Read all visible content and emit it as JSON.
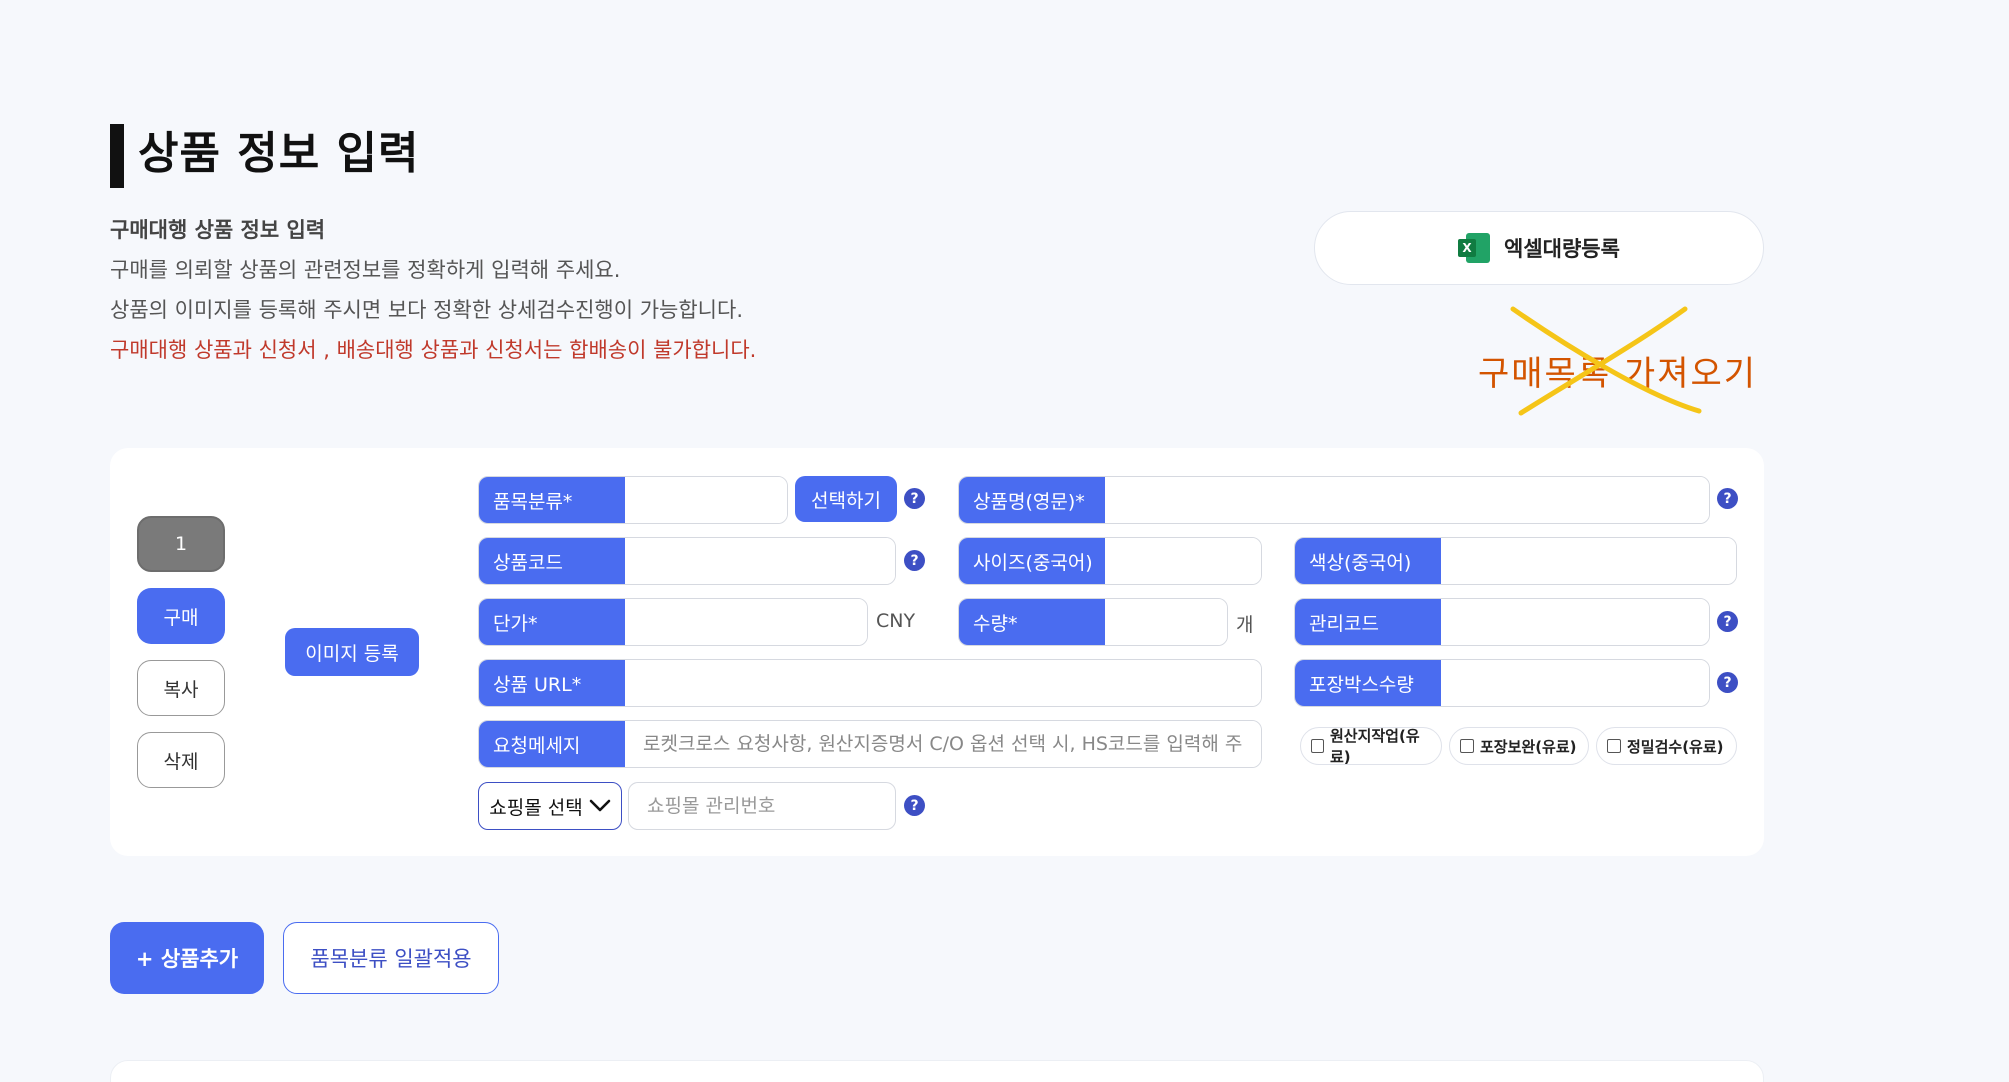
{
  "header": {
    "title": "상품 정보 입력",
    "subtitle": "구매대행 상품 정보 입력",
    "desc1": "구매를 의뢰할 상품의 관련정보를 정확하게 입력해 주세요.",
    "desc2": "상품의 이미지를 등록해 주시면 보다 정확한 상세검수진행이 가능합니다.",
    "warning": "구매대행 상품과 신청서 , 배송대행 상품과 신청서는 합배송이 불가합니다.",
    "excel_label": "엑셀대량등록",
    "excel_icon_letter": "X",
    "import_label": "구매목록 가져오기"
  },
  "item": {
    "index": "1",
    "buy_label": "구매",
    "copy_label": "복사",
    "delete_label": "삭제",
    "image_label": "이미지 등록"
  },
  "form": {
    "category_label": "품목분류*",
    "category_value": "",
    "select_label": "선택하기",
    "name_en_label": "상품명(영문)*",
    "name_en_value": "",
    "code_label": "상품코드",
    "code_value": "",
    "size_label": "사이즈(중국어)",
    "size_value": "",
    "color_label": "색상(중국어)",
    "color_value": "",
    "price_label": "단가*",
    "price_value": "",
    "price_unit": "CNY",
    "qty_label": "수량*",
    "qty_value": "",
    "qty_unit": "개",
    "mgmt_label": "관리코드",
    "mgmt_value": "",
    "url_label": "상품 URL*",
    "url_value": "",
    "box_label": "포장박스수량",
    "box_value": "",
    "request_label": "요청메세지",
    "request_placeholder": "로켓크로스 요청사항, 원산지증명서 C/O 옵션 선택 시, HS코드를 입력해 주세요",
    "mall_select_label": "쇼핑몰 선택",
    "mall_placeholder": "쇼핑몰 관리번호",
    "help_symbol": "?"
  },
  "options": [
    {
      "label": "원산지작업(유료)"
    },
    {
      "label": "포장보완(유료)"
    },
    {
      "label": "정밀검수(유료)"
    }
  ],
  "actions": {
    "add_label": "+ 상품추가",
    "bulk_label": "품목분류 일괄적용"
  },
  "colors": {
    "primary": "#4a6cf0",
    "help": "#3d4fc4",
    "warning": "#c0392b",
    "import": "#d35400",
    "cross": "#f5c518"
  }
}
